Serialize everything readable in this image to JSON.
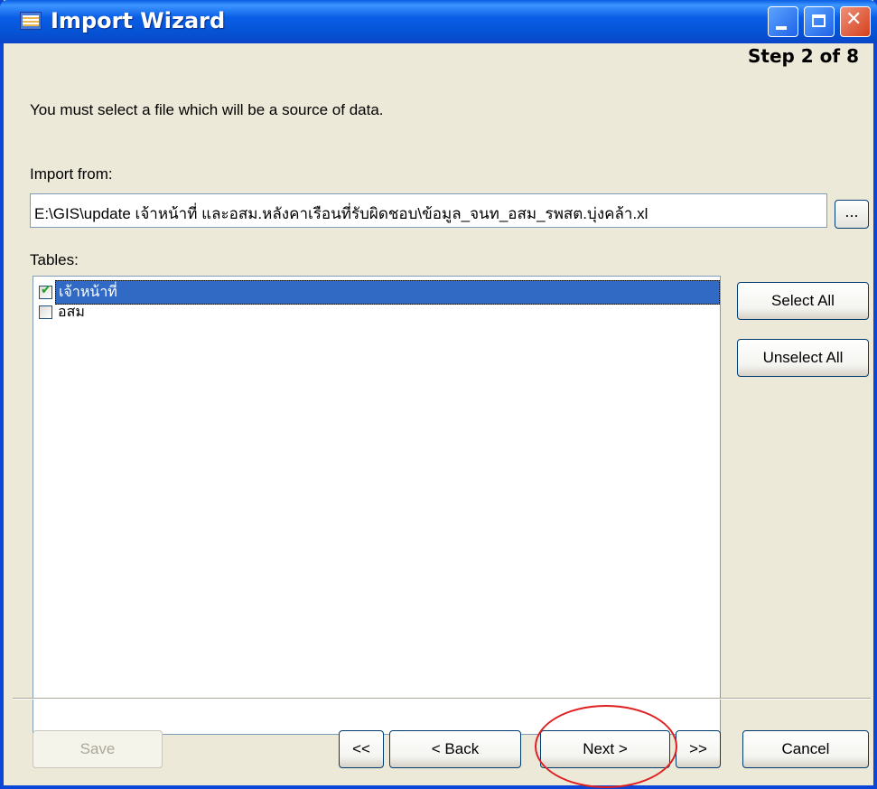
{
  "window": {
    "title": "Import Wizard",
    "step": "Step 2 of 8"
  },
  "instructions": "You must select a file which will be a source of data.",
  "import_from": {
    "label": "Import from:",
    "path": "E:\\GIS\\update เจ้าหน้าที่ และอสม.หลังคาเรือนที่รับผิดชอบ\\ข้อมูล_จนท_อสม_รพสต.บุ่งคล้า.xl",
    "browse_label": "..."
  },
  "tables": {
    "label": "Tables:",
    "items": [
      {
        "label": "เจ้าหน้าที่",
        "checked": true,
        "selected": true
      },
      {
        "label": "อสม",
        "checked": false,
        "selected": false
      }
    ],
    "select_all_label": "Select All",
    "unselect_all_label": "Unselect All"
  },
  "footer": {
    "save_label": "Save",
    "first_label": "<<",
    "back_label": "< Back",
    "next_label": "Next >",
    "last_label": ">>",
    "cancel_label": "Cancel"
  },
  "colors": {
    "titlebar": "#0a5ee6",
    "selection": "#316ac5",
    "annotation": "#e02020"
  }
}
